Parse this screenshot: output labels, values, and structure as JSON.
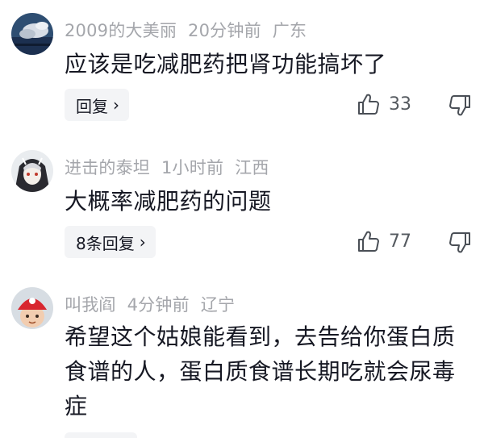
{
  "comments": [
    {
      "username": "2009的大美丽",
      "time": "20分钟前",
      "location": "广东",
      "text": "应该是吃减肥药把肾功能搞坏了",
      "reply_label": "回复",
      "likes": "33",
      "avatar_icon": "cloud-sky-avatar"
    },
    {
      "username": "进击的泰坦",
      "time": "1小时前",
      "location": "江西",
      "text": "大概率减肥药的问题",
      "reply_label": "8条回复",
      "likes": "77",
      "avatar_icon": "anime-character-avatar"
    },
    {
      "username": "叫我阎",
      "time": "4分钟前",
      "location": "辽宁",
      "text": "希望这个姑娘能看到，去告给你蛋白质食谱的人，蛋白质食谱长期吃就会尿毒症",
      "avatar_icon": "baby-red-hat-avatar"
    }
  ],
  "colors": {
    "meta": "#a4a6ab",
    "text": "#161823",
    "reply_bg": "#f3f4f6"
  }
}
